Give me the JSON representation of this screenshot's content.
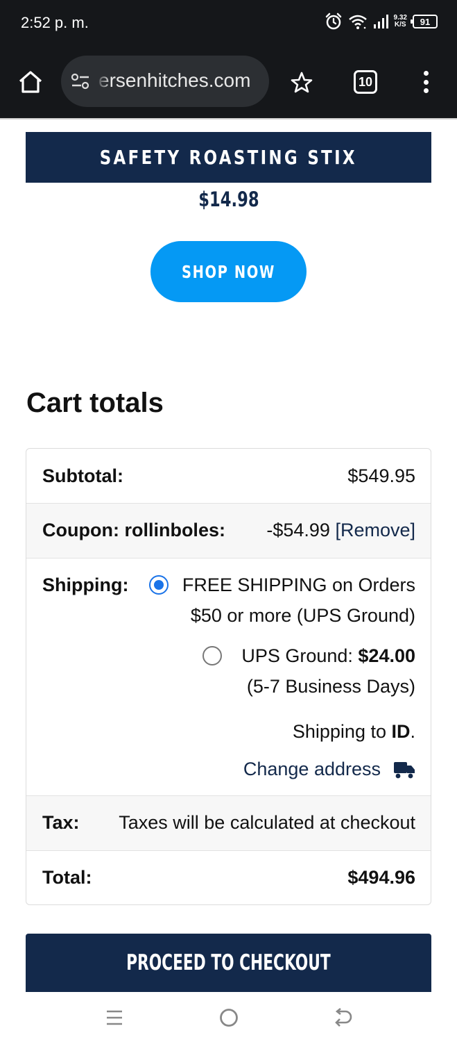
{
  "status_bar": {
    "time": "2:52 p. m.",
    "speed_value": "9.32",
    "speed_unit": "K/S",
    "battery": "91"
  },
  "browser": {
    "url": "ersenhitches.com",
    "tab_count": "10"
  },
  "product": {
    "title": "SAFETY ROASTING STIX",
    "price": "$14.98",
    "cta": "SHOP NOW"
  },
  "cart": {
    "heading": "Cart totals",
    "subtotal_label": "Subtotal:",
    "subtotal_value": "$549.95",
    "coupon_label": "Coupon: rollinboles:",
    "coupon_value": "-$54.99",
    "coupon_remove": "[Remove]",
    "shipping_label": "Shipping:",
    "shipping_options": [
      {
        "line1": "FREE SHIPPING on Orders",
        "line2": "$50 or more (UPS Ground)",
        "selected": true
      },
      {
        "line1_prefix": "UPS Ground: ",
        "line1_price": "$24.00",
        "line2": "(5-7 Business Days)",
        "selected": false
      }
    ],
    "shipping_to_prefix": "Shipping to ",
    "shipping_to_state": "ID",
    "shipping_to_suffix": ".",
    "change_address": "Change address",
    "tax_label": "Tax:",
    "tax_value": "Taxes will be calculated at checkout",
    "total_label": "Total:",
    "total_value": "$494.96"
  },
  "checkout": {
    "label": "PROCEED TO CHECKOUT"
  },
  "colors": {
    "navy": "#13294b",
    "shop_blue": "#0599f4",
    "radio_blue": "#1a73e8"
  }
}
